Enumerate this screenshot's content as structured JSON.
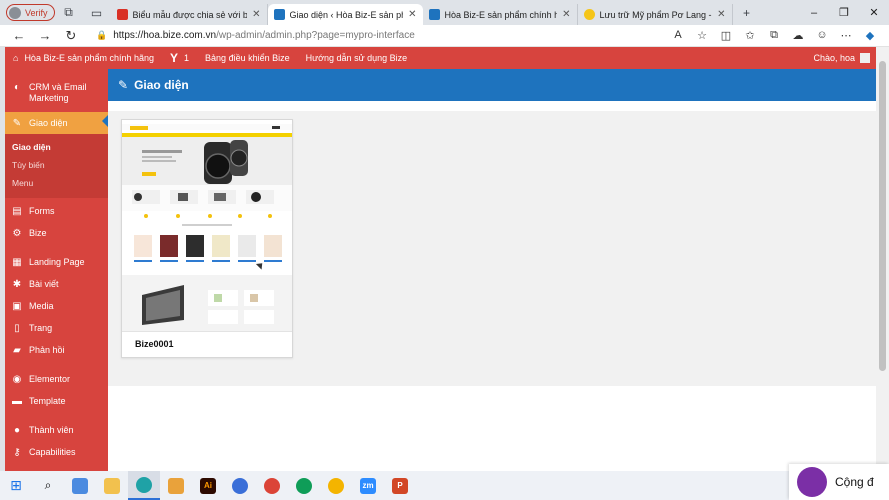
{
  "browser": {
    "profile": "Verify",
    "tabs": [
      {
        "title": "Biểu mẫu được chia sẻ với bạn: '",
        "color": "#d93025",
        "active": false
      },
      {
        "title": "Giao diện ‹ Hòa Biz-E sản phẩm ...",
        "color": "#1e73be",
        "active": true
      },
      {
        "title": "Hòa Biz-E sản phẩm chính hãng",
        "color": "#1e73be",
        "active": false
      },
      {
        "title": "Lưu trữ Mỹ phẩm Pơ Lang - Biz-E",
        "color": "#f5c518",
        "active": false
      }
    ],
    "new_tab": "+",
    "url_host": "https://hoa.bize.com.vn",
    "url_path": "/wp-admin/admin.php?page=mypro-interface",
    "window_controls": [
      "–",
      "❐",
      "✕"
    ]
  },
  "adminbar": {
    "site_name": "Hòa Biz-E sản phẩm chính hãng",
    "yoast_label": "Y",
    "yoast_count": "1",
    "link1": "Bảng điều khiển Bize",
    "link2": "Hướng dẫn sử dụng Bize",
    "greeting": "Chào, hoa"
  },
  "sidebar": {
    "crm": "CRM và Email Marketing",
    "appearance": "Giao diện",
    "sub_current": "Giao diện",
    "sub_customize": "Tùy biến",
    "sub_menu": "Menu",
    "forms": "Forms",
    "bize": "Bize",
    "landing": "Landing Page",
    "posts": "Bài viết",
    "media": "Media",
    "pages": "Trang",
    "comments": "Phản hồi",
    "elementor": "Elementor",
    "template": "Template",
    "users": "Thành viên",
    "capabilities": "Capabilities"
  },
  "content": {
    "page_title": "Giao diện",
    "theme_name": "Bize0001"
  },
  "taskbar": {
    "notification_text": "Cộng đ"
  },
  "colors": {
    "admin_red": "#d7443e",
    "active_orange": "#f0a141",
    "header_blue": "#1e73be"
  }
}
